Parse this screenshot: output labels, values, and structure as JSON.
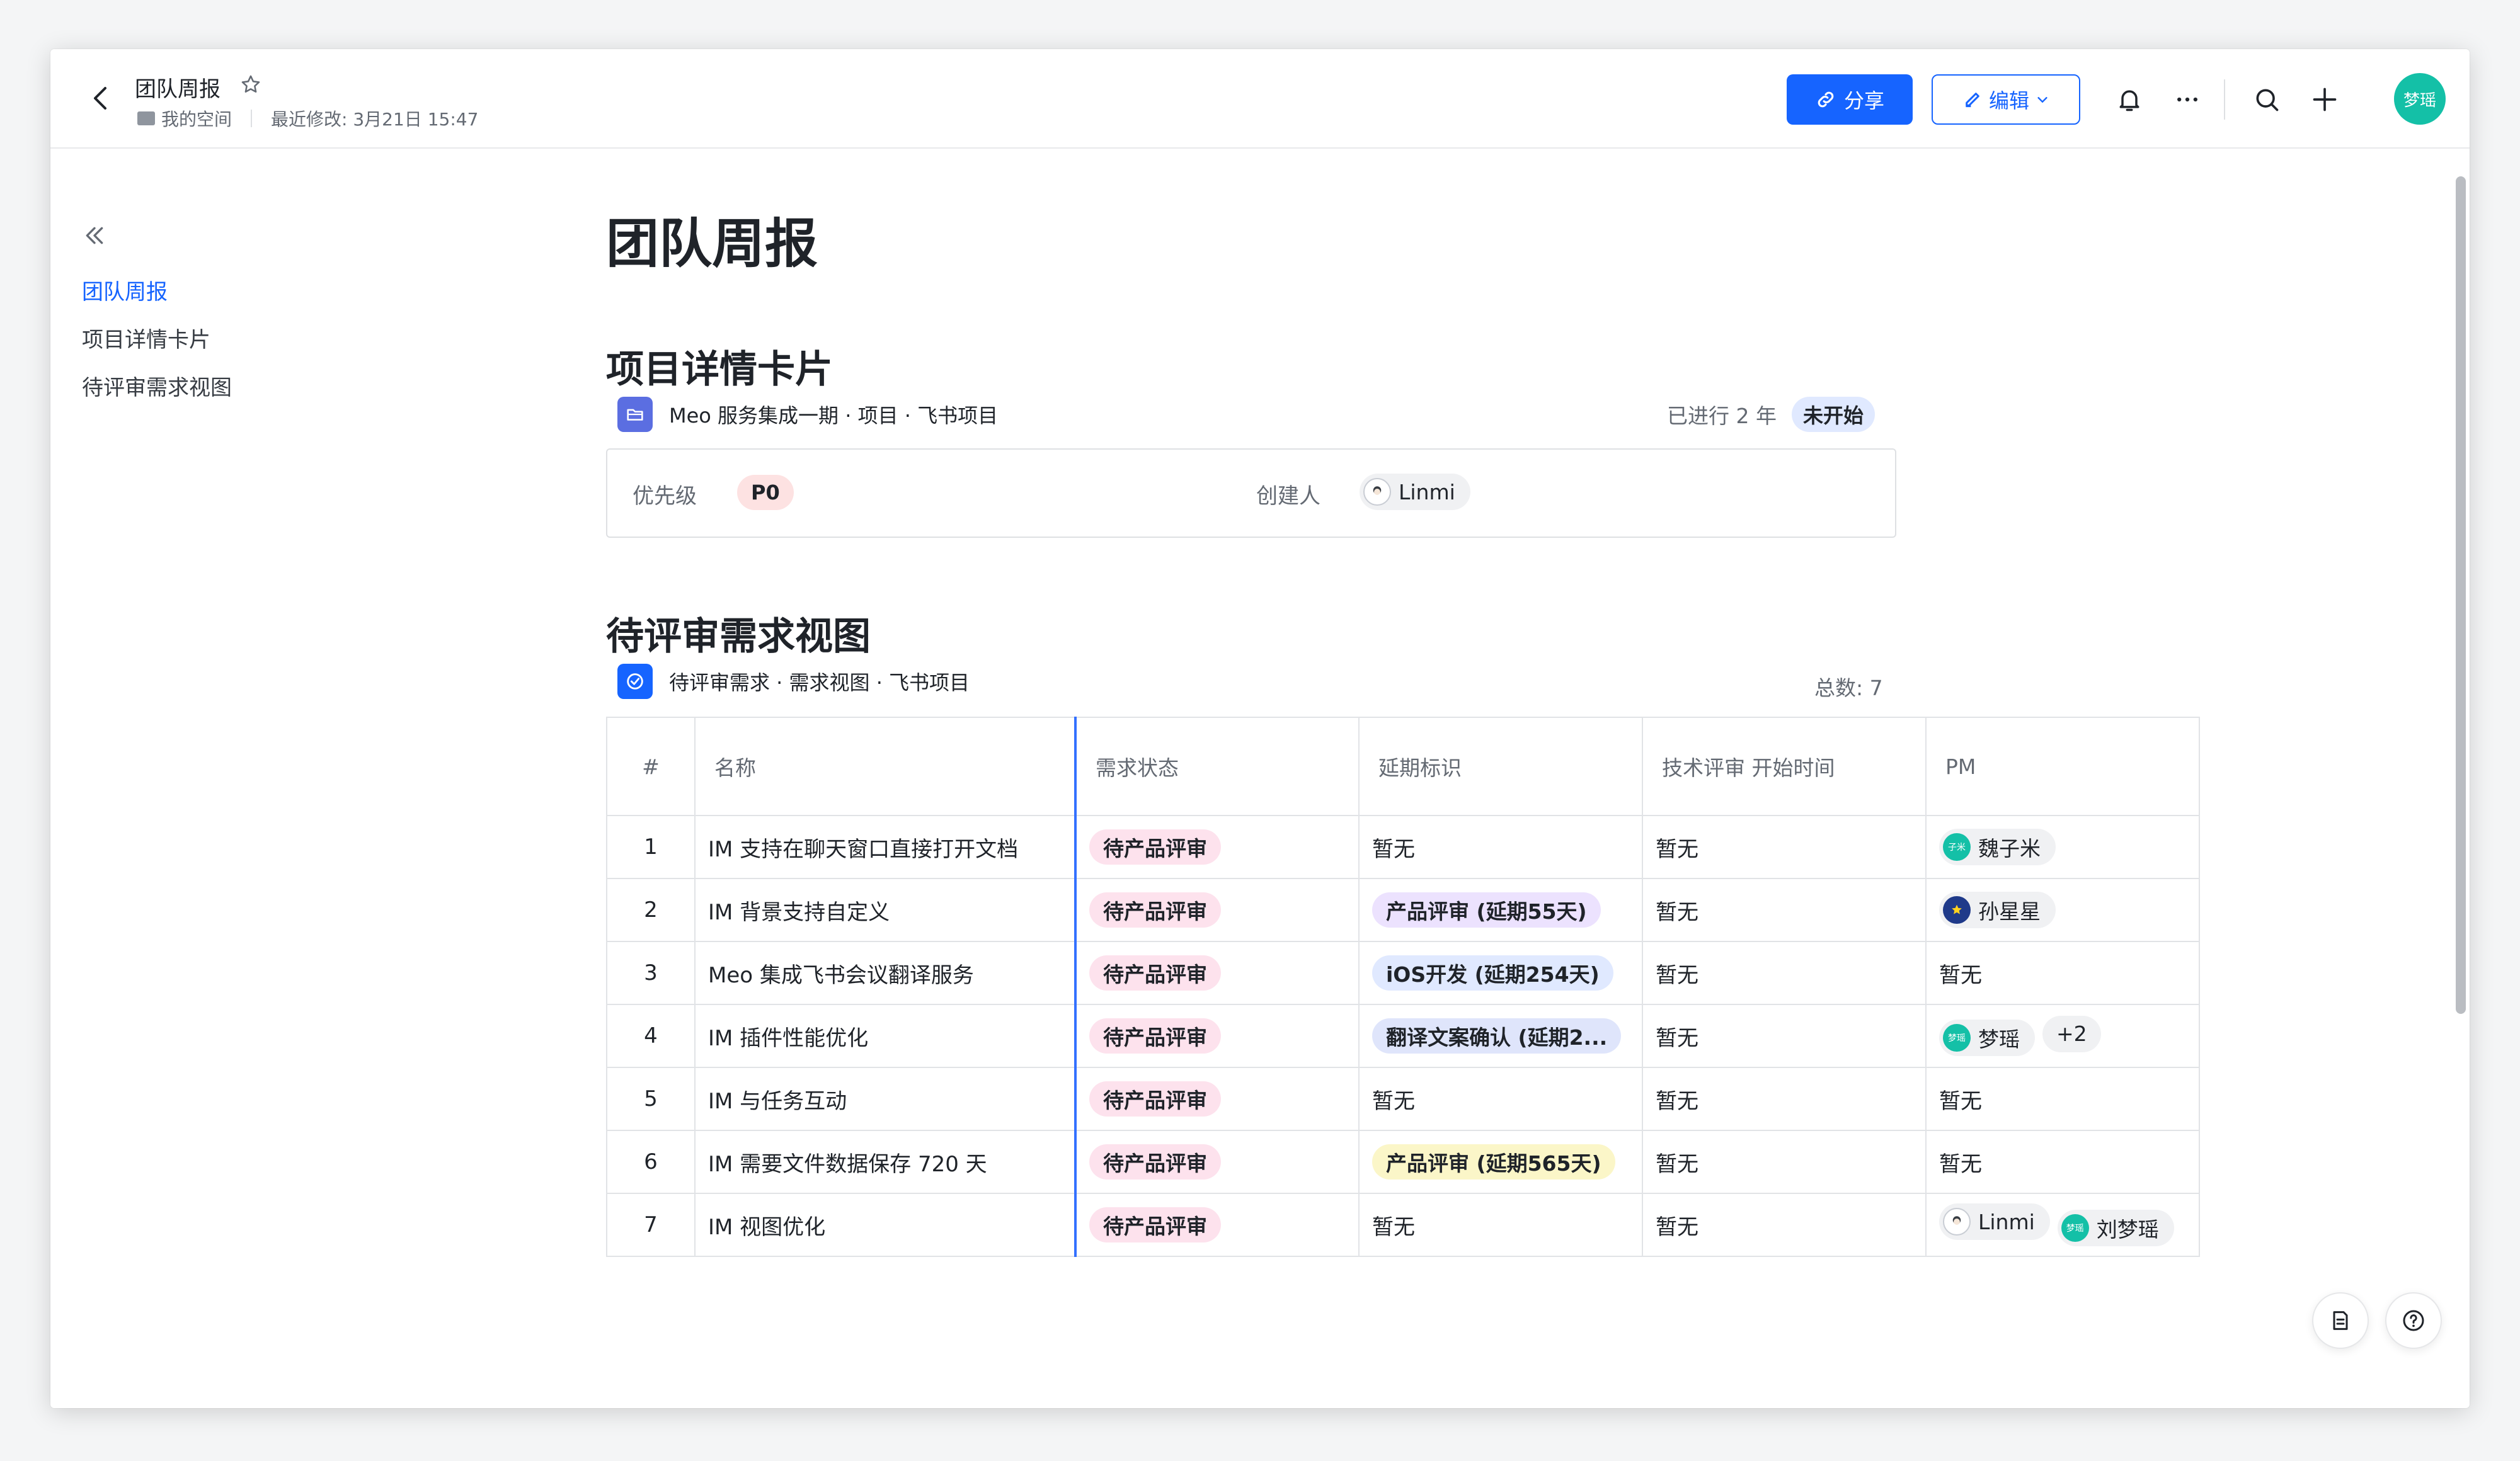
{
  "header": {
    "title": "团队周报",
    "space": "我的空间",
    "last_modified": "最近修改: 3月21日 15:47",
    "share_label": "分享",
    "edit_label": "编辑",
    "user_avatar": "梦瑶"
  },
  "toc": {
    "items": [
      "团队周报",
      "项目详情卡片",
      "待评审需求视图"
    ],
    "active": 0
  },
  "doc": {
    "title": "团队周报",
    "section1": "项目详情卡片",
    "section2": "待评审需求视图"
  },
  "project_card": {
    "name": "Meo 服务集成一期 · 项目 · 飞书项目",
    "elapsed": "已进行 2 年",
    "status": "未开始",
    "priority_label": "优先级",
    "priority": "P0",
    "creator_label": "创建人",
    "creator": "Linmi"
  },
  "view": {
    "name": "待评审需求 · 需求视图 · 飞书项目",
    "total": "总数: 7",
    "columns": [
      "#",
      "名称",
      "需求状态",
      "延期标识",
      "技术评审 开始时间",
      "PM"
    ],
    "rows": [
      {
        "no": "1",
        "name": "IM 支持在聊天窗口直接打开文档",
        "status": "待产品评审",
        "delay": "暂无",
        "delay_tag": "",
        "review": "暂无",
        "pm": [
          "魏子米"
        ],
        "pm_extra": ""
      },
      {
        "no": "2",
        "name": "IM 背景支持自定义",
        "status": "待产品评审",
        "delay": "",
        "delay_tag": "产品评审 (延期55天)",
        "review": "暂无",
        "pm": [
          "孙星星"
        ],
        "pm_extra": ""
      },
      {
        "no": "3",
        "name": "Meo 集成飞书会议翻译服务",
        "status": "待产品评审",
        "delay": "",
        "delay_tag": "iOS开发 (延期254天)",
        "review": "暂无",
        "pm_none": "暂无",
        "pm_extra": ""
      },
      {
        "no": "4",
        "name": "IM 插件性能优化",
        "status": "待产品评审",
        "delay": "",
        "delay_tag": "翻译文案确认 (延期2...",
        "review": "暂无",
        "pm": [
          "梦瑶"
        ],
        "pm_extra": "+2"
      },
      {
        "no": "5",
        "name": "IM 与任务互动",
        "status": "待产品评审",
        "delay": "暂无",
        "delay_tag": "",
        "review": "暂无",
        "pm_none": "暂无",
        "pm_extra": ""
      },
      {
        "no": "6",
        "name": "IM 需要文件数据保存 720 天",
        "status": "待产品评审",
        "delay": "",
        "delay_tag": "产品评审 (延期565天)",
        "review": "暂无",
        "pm_none": "暂无",
        "pm_extra": ""
      },
      {
        "no": "7",
        "name": "IM 视图优化",
        "status": "待产品评审",
        "delay": "暂无",
        "delay_tag": "",
        "review": "暂无",
        "pm": [
          "Linmi",
          "刘梦瑶"
        ],
        "pm_extra": ""
      }
    ]
  },
  "colors": {
    "accent": "#1664ff",
    "avatar_teal": "#14c0a7"
  }
}
